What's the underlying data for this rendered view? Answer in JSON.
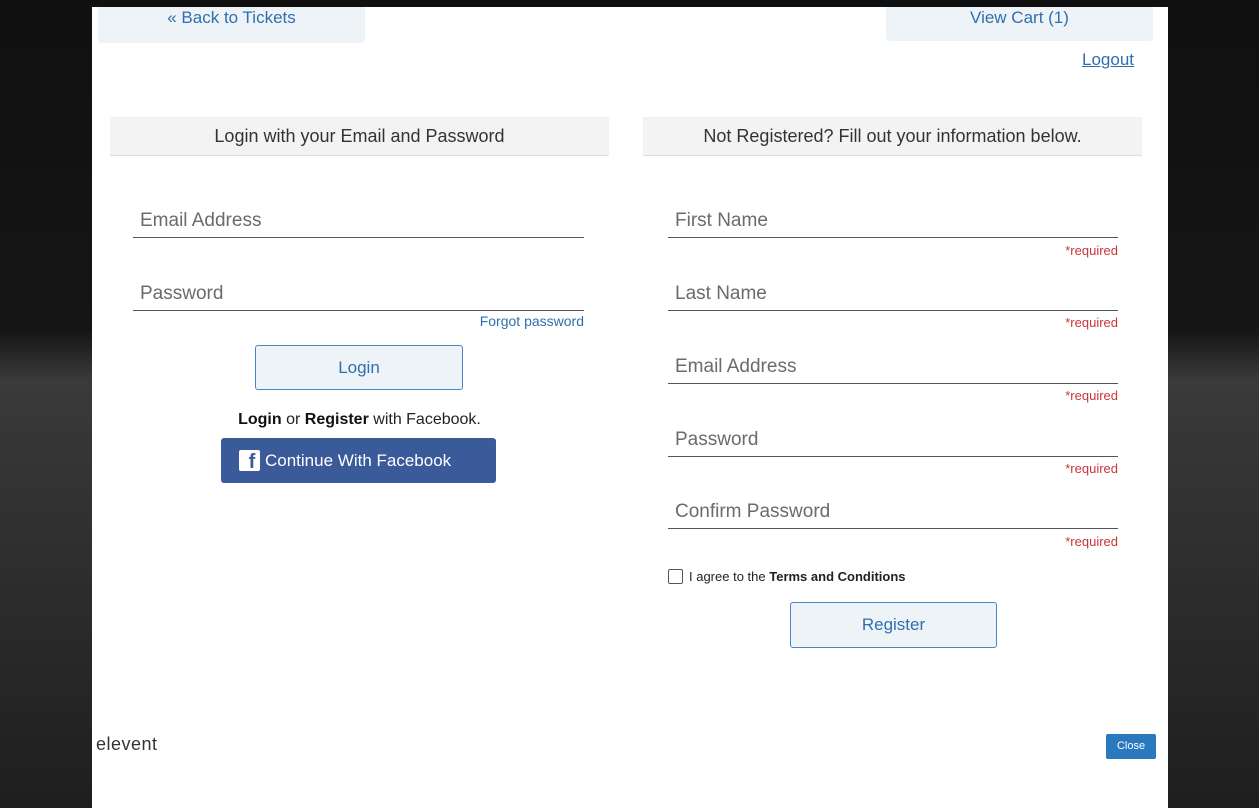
{
  "header": {
    "back_label": "« Back to Tickets",
    "cart_label": "View Cart (1)",
    "logout_label": "Logout"
  },
  "login": {
    "heading": "Login with your Email and Password",
    "email_placeholder": "Email Address",
    "password_placeholder": "Password",
    "forgot_label": "Forgot password",
    "login_button": "Login",
    "fb_login_word": "Login",
    "fb_or": " or ",
    "fb_register_word": "Register",
    "fb_suffix": " with Facebook.",
    "fb_button": "Continue With Facebook"
  },
  "register": {
    "heading": "Not Registered? Fill out your information below.",
    "fields": [
      {
        "placeholder": "First Name",
        "required": "*required"
      },
      {
        "placeholder": "Last Name",
        "required": "*required"
      },
      {
        "placeholder": "Email Address",
        "required": "*required"
      },
      {
        "placeholder": "Password",
        "required": "*required"
      },
      {
        "placeholder": "Confirm Password",
        "required": "*required"
      }
    ],
    "terms_prefix": "I agree to the ",
    "terms_link": "Terms and Conditions",
    "register_button": "Register"
  },
  "footer": {
    "logo_text": "elevent",
    "close_label": "Close"
  },
  "colors": {
    "accent": "#2e6fb0",
    "facebook": "#3b5a9a",
    "required": "#c9343b",
    "close_button": "#2a78be"
  }
}
